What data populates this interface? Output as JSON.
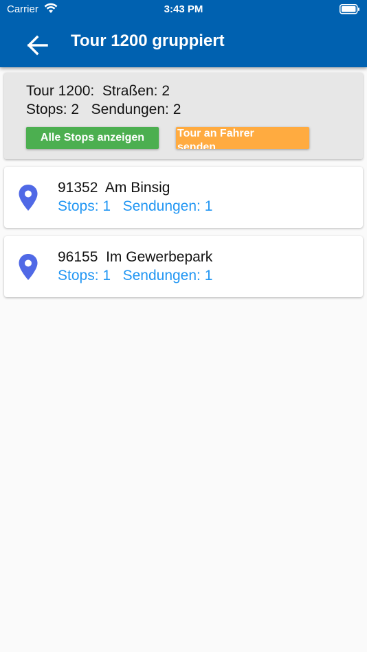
{
  "status_bar": {
    "carrier": "Carrier",
    "time": "3:43 PM"
  },
  "app_bar": {
    "title": "Tour 1200 gruppiert"
  },
  "summary": {
    "tour_label": "Tour 1200:",
    "strassen_label": "Straßen:",
    "strassen_value": "2",
    "stops_label": "Stops:",
    "stops_value": "2",
    "sendungen_label": "Sendungen:",
    "sendungen_value": "2",
    "show_all_button": "Alle Stops anzeigen",
    "send_to_driver_button": "Tour an Fahrer senden"
  },
  "colors": {
    "app_bar": "#0061b0",
    "green_button": "#4caf50",
    "orange_button": "#ffab40",
    "pin": "#5069e6",
    "link_text": "#2196f3"
  },
  "streets": [
    {
      "zip": "91352",
      "street": "Am Binsig",
      "stops_label": "Stops:",
      "stops": "1",
      "sendungen_label": "Sendungen:",
      "sendungen": "1",
      "icon": "location-pin-icon"
    },
    {
      "zip": "96155",
      "street": "Im Gewerbepark",
      "stops_label": "Stops:",
      "stops": "1",
      "sendungen_label": "Sendungen:",
      "sendungen": "1",
      "icon": "location-pin-icon"
    }
  ]
}
